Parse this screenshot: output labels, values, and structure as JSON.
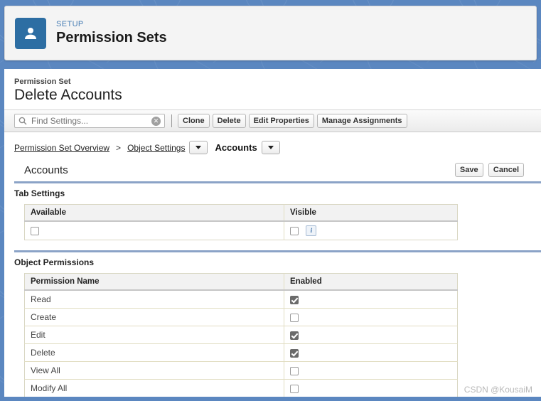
{
  "setup_header": {
    "eyebrow": "SETUP",
    "title": "Permission Sets",
    "avatar_icon": "user-icon"
  },
  "record": {
    "object_label": "Permission Set",
    "name": "Delete Accounts"
  },
  "toolbar": {
    "search": {
      "icon": "search-icon",
      "placeholder": "Find Settings...",
      "value": "",
      "clear_icon": "clear-circle-icon",
      "clear_glyph": "✕"
    },
    "buttons": [
      {
        "label": "Clone"
      },
      {
        "label": "Delete"
      },
      {
        "label": "Edit Properties"
      },
      {
        "label": "Manage Assignments"
      }
    ]
  },
  "breadcrumb": {
    "overview_link": "Permission Set Overview",
    "separator": ">",
    "object_settings_link": "Object Settings",
    "current": "Accounts",
    "dropdown_icon": "chevron-down-icon"
  },
  "section": {
    "title": "Accounts",
    "save_label": "Save",
    "cancel_label": "Cancel"
  },
  "tab_settings": {
    "heading": "Tab Settings",
    "columns": [
      "Available",
      "Visible"
    ],
    "row": {
      "available_checked": false,
      "visible_checked": false,
      "info_icon": "info-icon",
      "info_glyph": "i"
    }
  },
  "object_permissions": {
    "heading": "Object Permissions",
    "columns": [
      "Permission Name",
      "Enabled"
    ],
    "rows": [
      {
        "name": "Read",
        "enabled": true
      },
      {
        "name": "Create",
        "enabled": false
      },
      {
        "name": "Edit",
        "enabled": true
      },
      {
        "name": "Delete",
        "enabled": true
      },
      {
        "name": "View All",
        "enabled": false
      },
      {
        "name": "Modify All",
        "enabled": false
      }
    ]
  },
  "watermark": "CSDN @KousaiM",
  "colors": {
    "backdrop_blue": "#5b87c0",
    "avatar_blue": "#2d6ea3",
    "eyebrow_blue": "#4a7fb5",
    "rule_blue": "#8ba3c7",
    "row_border": "#e1ddc2",
    "checkbox_checked": "#6b6b6b"
  }
}
